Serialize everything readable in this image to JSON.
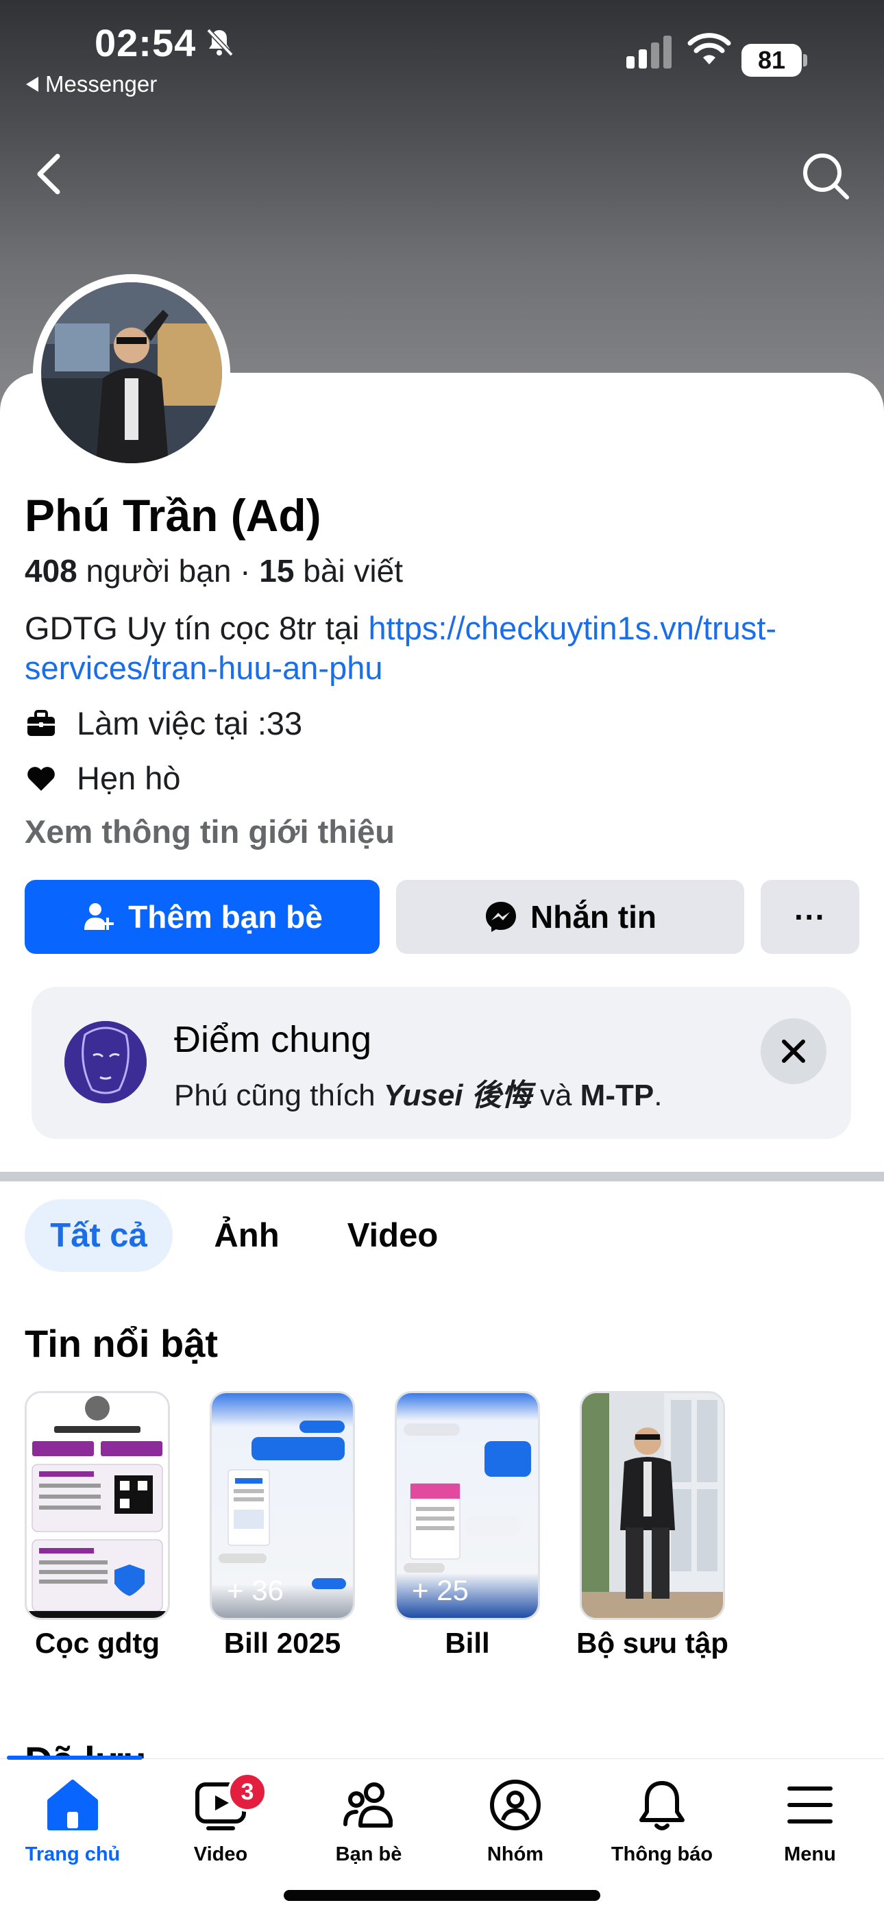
{
  "status_bar": {
    "time": "02:54",
    "back_app": "Messenger",
    "battery": "81"
  },
  "profile": {
    "name": "Phú Trần (Ad)",
    "friends_count": "408",
    "friends_label": " người bạn · ",
    "posts_count": "15",
    "posts_label": " bài viết",
    "bio_text": "GDTG Uy tín cọc 8tr tại ",
    "bio_link": "https://checkuytin1s.vn/trust-services/tran-huu-an-phu",
    "work": "Làm việc tại :33",
    "relationship": "Hẹn hò",
    "see_intro": "Xem thông tin giới thiệu"
  },
  "actions": {
    "add_friend": "Thêm bạn bè",
    "message": "Nhắn tin",
    "more": "···"
  },
  "mutual": {
    "title": "Điểm chung",
    "prefix": "Phú cũng thích ",
    "page1": "Yusei 後悔",
    "conj": " và ",
    "page2": "M-TP",
    "suffix": "."
  },
  "tabs": [
    {
      "label": "Tất cả",
      "active": true
    },
    {
      "label": "Ảnh",
      "active": false
    },
    {
      "label": "Video",
      "active": false
    }
  ],
  "highlights_title": "Tin nổi bật",
  "highlights": [
    {
      "label": "Cọc gdtg",
      "count": ""
    },
    {
      "label": "Bill 2025",
      "count": "+ 36"
    },
    {
      "label": "Bill",
      "count": "+ 25"
    },
    {
      "label": "Bộ sưu tập",
      "count": ""
    }
  ],
  "next_section_partial": "Đã lưu",
  "bottom_nav": [
    {
      "label": "Trang chủ",
      "active": true
    },
    {
      "label": "Video",
      "badge": "3"
    },
    {
      "label": "Bạn bè"
    },
    {
      "label": "Nhóm"
    },
    {
      "label": "Thông báo"
    },
    {
      "label": "Menu"
    }
  ],
  "colors": {
    "primary_blue": "#0866ff",
    "link_blue": "#1b6de8",
    "badge_red": "#e41e3f",
    "secondary_gray": "#e4e6eb"
  }
}
